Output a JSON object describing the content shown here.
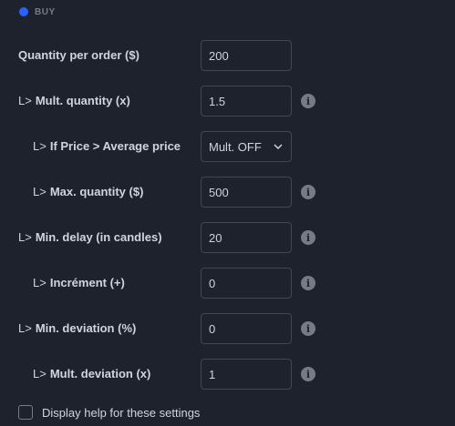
{
  "section": {
    "label": "BUY",
    "accent": "#2962ff"
  },
  "arrow_glyph": "L>",
  "rows": [
    {
      "label": "Quantity per order ($)",
      "value": "200"
    },
    {
      "label": "Mult. quantity (x)",
      "value": "1.5"
    },
    {
      "label": "If Price > Average price",
      "value": "Mult. OFF"
    },
    {
      "label": "Max. quantity ($)",
      "value": "500"
    },
    {
      "label": "Min. delay (in candles)",
      "value": "20"
    },
    {
      "label": "Incrément (+)",
      "value": "0"
    },
    {
      "label": "Min. deviation (%)",
      "value": "0"
    },
    {
      "label": "Mult. deviation (x)",
      "value": "1"
    }
  ],
  "info_glyph": "i",
  "help": {
    "label": "Display help for these settings",
    "checked": false
  },
  "icons": {
    "info": "info-icon",
    "dropdown": "chevron-down-icon",
    "section": "blue-dot-icon"
  }
}
